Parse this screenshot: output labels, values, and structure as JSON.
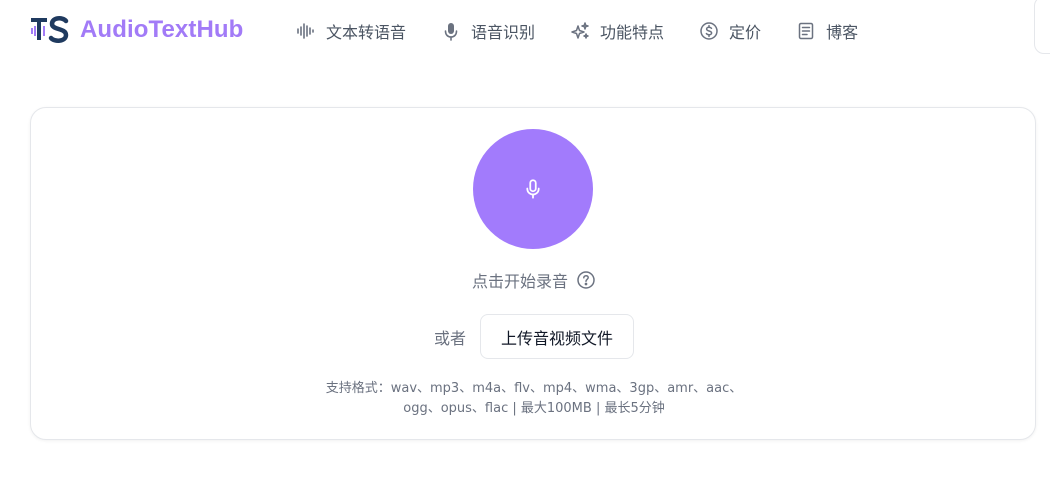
{
  "brand": {
    "name": "AudioTextHub",
    "logo_letters": "TS",
    "accent_color": "#a27bf7"
  },
  "nav": {
    "items": [
      {
        "label": "文本转语音",
        "icon": "sound-wave-icon"
      },
      {
        "label": "语音识别",
        "icon": "microphone-icon"
      },
      {
        "label": "功能特点",
        "icon": "sparkles-icon"
      },
      {
        "label": "定价",
        "icon": "dollar-circle-icon"
      },
      {
        "label": "博客",
        "icon": "document-icon"
      }
    ]
  },
  "recorder": {
    "button_color": "#a27bfc",
    "hint": "点击开始录音",
    "or_label": "或者",
    "upload_label": "上传音视频文件",
    "formats_line1": "支持格式：wav、mp3、m4a、flv、mp4、wma、3gp、amr、aac、",
    "formats_line2": "ogg、opus、flac | 最大100MB | 最长5分钟"
  }
}
